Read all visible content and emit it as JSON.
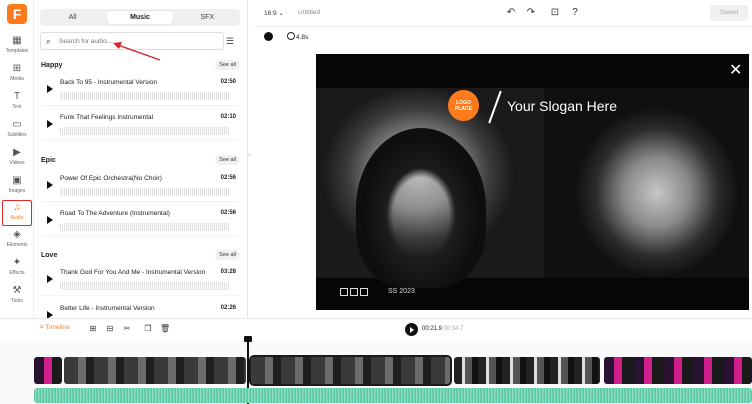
{
  "rail": {
    "logo_letter": "F",
    "items": [
      {
        "label": "Templates",
        "icon": "templates-icon"
      },
      {
        "label": "Media",
        "icon": "media-icon"
      },
      {
        "label": "Text",
        "icon": "text-icon"
      },
      {
        "label": "Subtitles",
        "icon": "subtitles-icon"
      },
      {
        "label": "Videos",
        "icon": "videos-icon"
      },
      {
        "label": "Images",
        "icon": "images-icon"
      },
      {
        "label": "Audio",
        "icon": "audio-icon",
        "active": true
      },
      {
        "label": "Elements",
        "icon": "elements-icon"
      },
      {
        "label": "Effects",
        "icon": "effects-icon"
      },
      {
        "label": "Tools",
        "icon": "tools-icon"
      }
    ]
  },
  "panel": {
    "tabs": [
      "All",
      "Music",
      "SFX"
    ],
    "active_tab": "Music",
    "search_placeholder": "Search for audio...",
    "see_all": "See all",
    "categories": [
      {
        "title": "Happy",
        "tracks": [
          {
            "name": "Back To 95 - Instrumental Version",
            "duration": "02:50"
          },
          {
            "name": "Funk That Feelings Instrumental",
            "duration": "02:10"
          }
        ]
      },
      {
        "title": "Epic",
        "tracks": [
          {
            "name": "Power Of Epic Orchestra(No Choir)",
            "duration": "02:56"
          },
          {
            "name": "Road To The Adventure (Instrumental)",
            "duration": "02:56"
          }
        ]
      },
      {
        "title": "Love",
        "tracks": [
          {
            "name": "Thank God For You And Me - Instrumental Version",
            "duration": "03:28"
          },
          {
            "name": "Better Life - Instrumental Version",
            "duration": "02:26"
          }
        ]
      }
    ]
  },
  "topbar": {
    "ratio": "16:9",
    "title": "Untitled",
    "saved_label": "Saved"
  },
  "editor": {
    "duration": "4.8s"
  },
  "canvas": {
    "logo_text": "LOGO PLACE",
    "slogan": "Your Slogan Here",
    "season": "SS 2023"
  },
  "timeline": {
    "label": "Timeline",
    "current_time": "00:21.9",
    "total_time": "/ 00:34.7"
  },
  "colors": {
    "brand": "#ff7a1a",
    "highlight": "#e0262a",
    "audio_wave": "#58c7a1"
  }
}
